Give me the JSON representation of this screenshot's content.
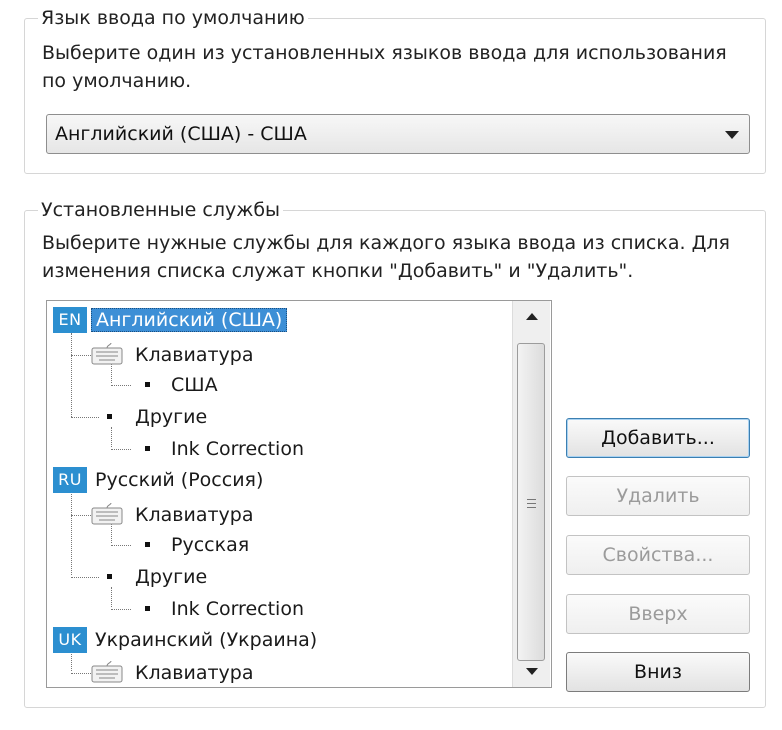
{
  "default_language": {
    "legend": "Язык ввода по умолчанию",
    "description_line1": "Выберите один из установленных языков ввода для использования",
    "description_line2": "по умолчанию.",
    "selected_value": "Английский (США) - США"
  },
  "installed_services": {
    "legend": "Установленные службы",
    "description_line1": "Выберите нужные службы для каждого языка ввода из списка. Для",
    "description_line2": "изменения списка служат кнопки \"Добавить\" и \"Удалить\".",
    "tree": {
      "en_badge": "EN",
      "en_label": "Английский (США)",
      "en_keyboard": "Клавиатура",
      "en_keyboard_item": "США",
      "en_other": "Другие",
      "en_other_item": "Ink Correction",
      "ru_badge": "RU",
      "ru_label": "Русский (Россия)",
      "ru_keyboard": "Клавиатура",
      "ru_keyboard_item": "Русская",
      "ru_other": "Другие",
      "ru_other_item": "Ink Correction",
      "uk_badge": "UK",
      "uk_label": "Украинский (Украина)",
      "uk_keyboard": "Клавиатура"
    },
    "buttons": {
      "add": "Добавить...",
      "remove": "Удалить",
      "properties": "Свойства...",
      "move_up": "Вверх",
      "move_down": "Вниз"
    }
  },
  "colors": {
    "selection": "#3d8fd6",
    "badge": "#2c8fd0",
    "disabled_text": "#9b9b9b"
  }
}
